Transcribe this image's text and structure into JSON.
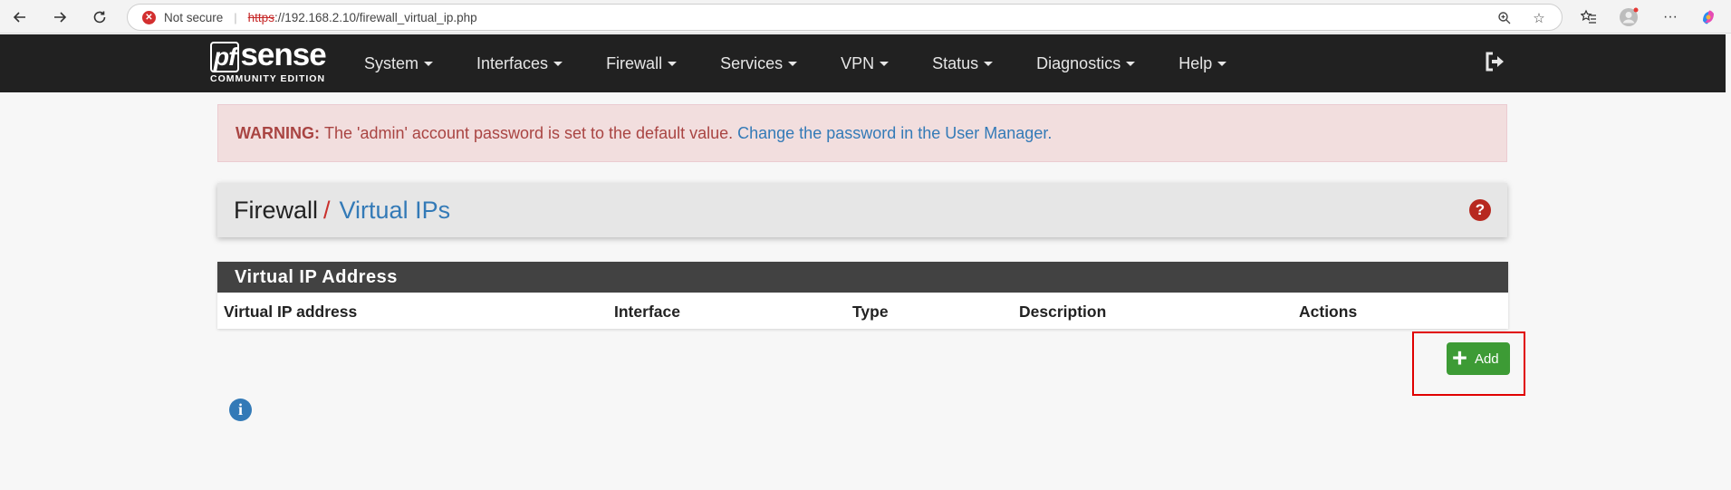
{
  "browser": {
    "security_label": "Not secure",
    "url_scheme": "https",
    "url_rest": "://192.168.2.10/firewall_virtual_ip.php"
  },
  "logo": {
    "pf": "pf",
    "sense": "sense",
    "edition": "COMMUNITY EDITION"
  },
  "nav": {
    "items": [
      {
        "label": "System"
      },
      {
        "label": "Interfaces"
      },
      {
        "label": "Firewall"
      },
      {
        "label": "Services"
      },
      {
        "label": "VPN"
      },
      {
        "label": "Status"
      },
      {
        "label": "Diagnostics"
      },
      {
        "label": "Help"
      }
    ]
  },
  "warning": {
    "prefix": "WARNING:",
    "text": "The 'admin' account password is set to the default value.",
    "link": "Change the password in the User Manager."
  },
  "breadcrumb": {
    "section": "Firewall",
    "separator": "/",
    "current": "Virtual IPs"
  },
  "panel": {
    "title": "Virtual IP Address",
    "columns": [
      "Virtual IP address",
      "Interface",
      "Type",
      "Description",
      "Actions"
    ]
  },
  "add_button": {
    "label": "Add"
  },
  "colors": {
    "navbar": "#212121",
    "link": "#337ab7",
    "add_button": "#3d9b35",
    "warning_bg": "#f2dede",
    "highlight": "#e00000"
  }
}
